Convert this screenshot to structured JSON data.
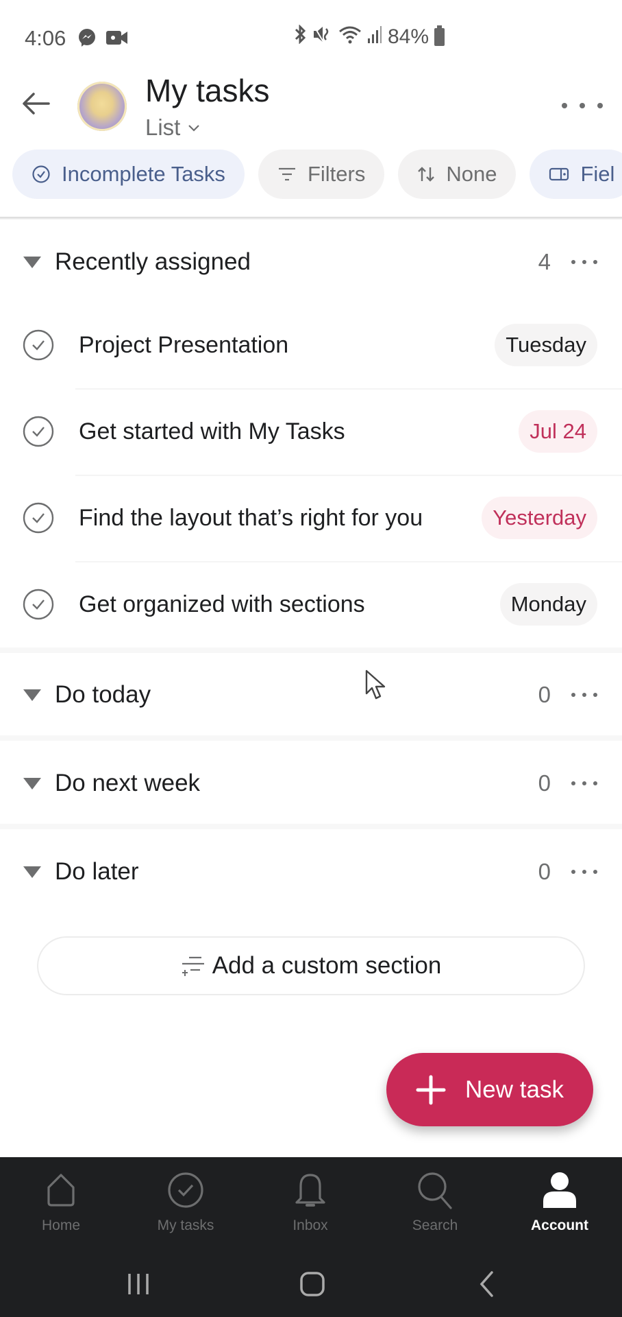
{
  "status_bar": {
    "time": "4:06",
    "battery": "84%",
    "left_icons": [
      "messenger-icon",
      "video-icon"
    ],
    "right_icons": [
      "bluetooth-icon",
      "mute-icon",
      "wifi-icon",
      "signal-icon",
      "battery-icon"
    ]
  },
  "header": {
    "title": "My tasks",
    "view": "List",
    "back_icon": "arrow-left-icon",
    "more_icon": "more-horizontal-icon"
  },
  "chips": [
    {
      "label": "Incomplete Tasks",
      "icon": "check-circle-icon",
      "style": "blue"
    },
    {
      "label": "Filters",
      "icon": "filter-icon",
      "style": "gray"
    },
    {
      "label": "None",
      "icon": "sort-icon",
      "style": "gray"
    },
    {
      "label": "Fiel",
      "icon": "fields-icon",
      "style": "blue"
    }
  ],
  "sections": [
    {
      "title": "Recently assigned",
      "count": "4",
      "tasks": [
        {
          "name": "Project Presentation",
          "due": "Tuesday",
          "overdue": false
        },
        {
          "name": "Get started with My Tasks",
          "due": "Jul 24",
          "overdue": true
        },
        {
          "name": "Find the layout that’s right for you",
          "due": "Yesterday",
          "overdue": true
        },
        {
          "name": "Get organized with sections",
          "due": "Monday",
          "overdue": false
        }
      ]
    },
    {
      "title": "Do today",
      "count": "0",
      "tasks": []
    },
    {
      "title": "Do next week",
      "count": "0",
      "tasks": []
    },
    {
      "title": "Do later",
      "count": "0",
      "tasks": []
    }
  ],
  "add_section_label": "Add a custom section",
  "fab_label": "New task",
  "bottom_nav": [
    {
      "label": "Home",
      "icon": "home-icon",
      "active": false
    },
    {
      "label": "My tasks",
      "icon": "check-circle-icon",
      "active": false
    },
    {
      "label": "Inbox",
      "icon": "bell-icon",
      "active": false
    },
    {
      "label": "Search",
      "icon": "search-icon",
      "active": false
    },
    {
      "label": "Account",
      "icon": "person-icon",
      "active": true
    }
  ],
  "colors": {
    "accent": "#c92a57",
    "overdue_text": "#c0305a",
    "chip_blue_bg": "#eef1fa",
    "chip_blue_text": "#4a5f8c",
    "nav_bg": "#1e1f21"
  }
}
